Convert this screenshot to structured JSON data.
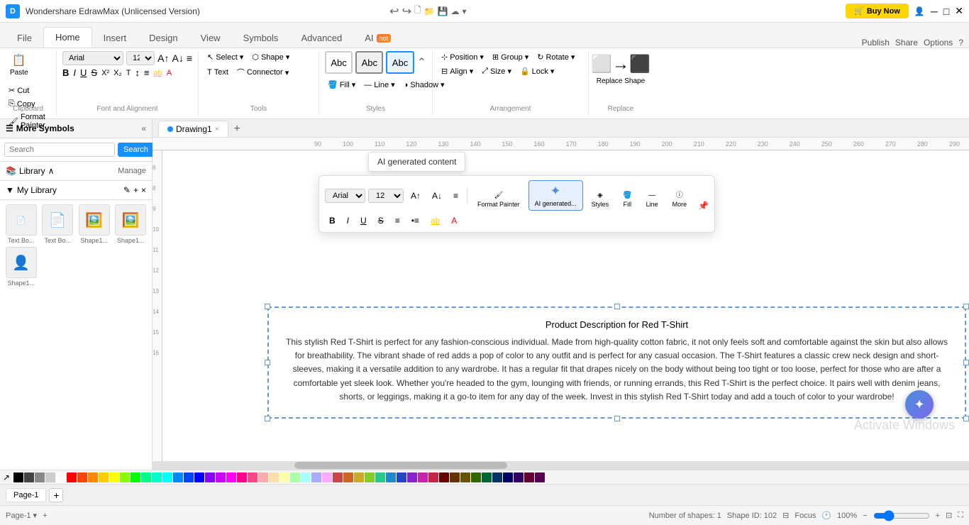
{
  "app": {
    "title": "Wondershare EdrawMax (Unlicensed Version)",
    "logo_text": "D"
  },
  "title_bar": {
    "buy_now": "Buy Now",
    "publish": "Publish",
    "share": "Share",
    "options": "Options",
    "help": "?"
  },
  "tabs": {
    "items": [
      "File",
      "Home",
      "Insert",
      "Design",
      "View",
      "Symbols",
      "Advanced",
      "AI"
    ]
  },
  "ribbon": {
    "clipboard": {
      "label": "Clipboard",
      "paste": "Paste",
      "cut": "Cut",
      "copy": "Copy",
      "format_painter": "Format Painter"
    },
    "font": {
      "label": "Font and Alignment",
      "font_name": "Arial",
      "font_size": "12",
      "bold": "B",
      "italic": "I",
      "underline": "U",
      "strikethrough": "S"
    },
    "tools": {
      "label": "Tools",
      "select": "Select",
      "shape": "Shape",
      "text": "Text",
      "connector": "Connector"
    },
    "styles": {
      "label": "Styles",
      "fill": "Fill",
      "line": "Line",
      "shadow": "Shadow"
    },
    "arrangement": {
      "label": "Arrangement",
      "position": "Position",
      "group": "Group",
      "rotate": "Rotate",
      "align": "Align",
      "size": "Size",
      "lock": "Lock"
    },
    "replace": {
      "label": "Replace",
      "replace_shape": "Replace Shape"
    }
  },
  "left_panel": {
    "title": "More Symbols",
    "search_placeholder": "Search",
    "search_btn": "Search",
    "library_label": "Library",
    "manage_label": "Manage",
    "my_library_label": "My Library",
    "thumbnails": [
      {
        "label": "Text Bo...",
        "icon": "📄"
      },
      {
        "label": "Text Bo...",
        "icon": "📄"
      },
      {
        "label": "Shape1...",
        "icon": "🖼️"
      },
      {
        "label": "Shape1...",
        "icon": "🖼️"
      },
      {
        "label": "Shape1...",
        "icon": "👤"
      }
    ]
  },
  "drawing_tab": {
    "name": "Drawing1",
    "close": "×",
    "add": "+"
  },
  "floating_toolbar": {
    "font": "Arial",
    "size": "12",
    "bold": "B",
    "italic": "I",
    "underline": "U",
    "strikethrough": "S",
    "format_painter_label": "Format Painter",
    "ai_label": "AI generated...",
    "styles_label": "Styles",
    "fill_label": "Fill",
    "line_label": "Line",
    "more_label": "More"
  },
  "ai_tooltip": {
    "text": "AI generated content"
  },
  "canvas": {
    "content_title": "Product Description for Red T-Shirt",
    "content_body": "This stylish Red T-Shirt is perfect for any fashion-conscious individual. Made from high-quality cotton fabric, it not only feels soft and comfortable against the skin but also allows for breathability. The vibrant shade of red adds a pop of color to any outfit and is perfect for any casual occasion. The T-Shirt features a classic crew neck design and short-sleeves, making it a versatile addition to any wardrobe. It has a regular fit that drapes nicely on the body without being too tight or too loose, perfect for those who are after a comfortable yet sleek look. Whether you're headed to the gym, lounging with friends, or running errands, this Red T-Shirt is the perfect choice. It pairs well with denim jeans, shorts, or leggings, making it a go-to item for any day of the week. Invest in this stylish Red T-Shirt today and add a touch of color to your wardrobe!"
  },
  "bottom_bar": {
    "page_label": "Page-1",
    "page_dropdown": "▾",
    "add_page": "+",
    "shapes_count": "Number of shapes: 1",
    "shape_id": "Shape ID: 102",
    "focus": "Focus",
    "zoom": "100%",
    "fit": "⊡"
  },
  "colors": [
    "#000000",
    "#444444",
    "#888888",
    "#cccccc",
    "#ffffff",
    "#ff0000",
    "#ff4400",
    "#ff8800",
    "#ffcc00",
    "#ffff00",
    "#88ff00",
    "#00ff00",
    "#00ff88",
    "#00ffcc",
    "#00ffff",
    "#0088ff",
    "#0044ff",
    "#0000ff",
    "#8800ff",
    "#cc00ff",
    "#ff00ff",
    "#ff0088",
    "#ff4488",
    "#ffaaaa",
    "#ffddaa",
    "#ffffaa",
    "#aaffaa",
    "#aaffff",
    "#aaaaff",
    "#ffaaff",
    "#cc4444",
    "#cc6622",
    "#ccaa22",
    "#88cc22",
    "#22cc88",
    "#2288cc",
    "#2244cc",
    "#8822cc",
    "#cc22aa",
    "#cc2244",
    "#660000",
    "#663300",
    "#665500",
    "#336600",
    "#006633",
    "#003366",
    "#000066",
    "#330066",
    "#660033",
    "#550055"
  ]
}
